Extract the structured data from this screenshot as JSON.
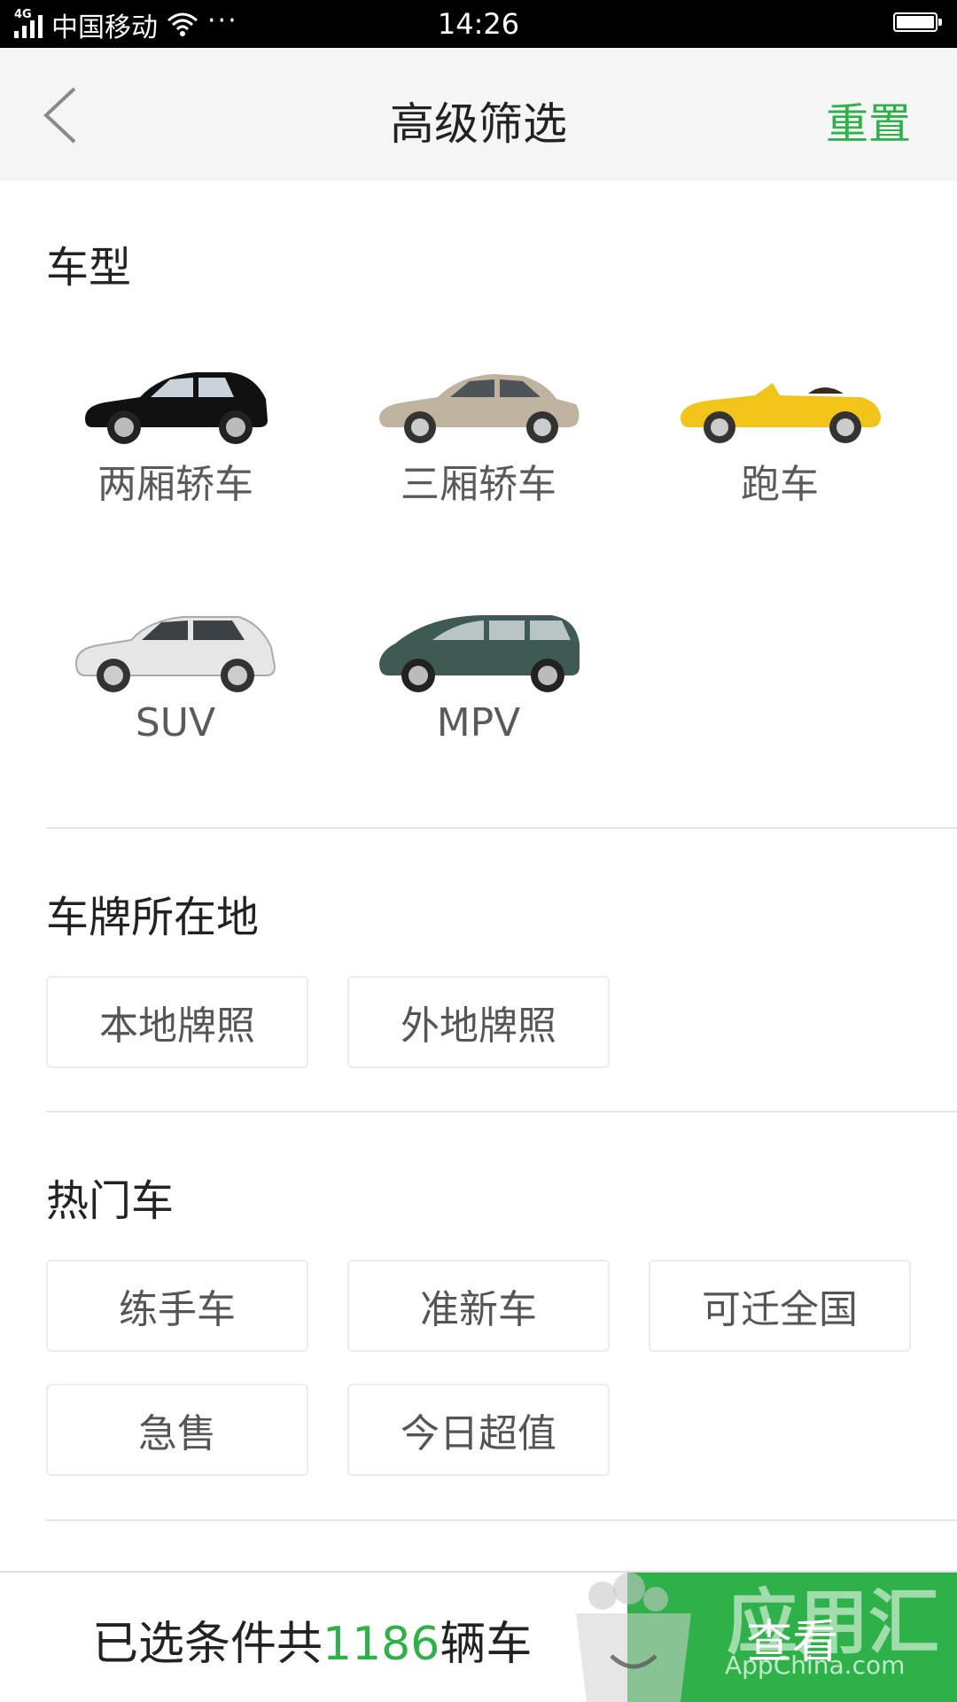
{
  "status_bar": {
    "network": "4G",
    "carrier": "中国移动",
    "more": "···",
    "time": "14:26"
  },
  "header": {
    "title": "高级筛选",
    "reset_label": "重置"
  },
  "sections": {
    "car_type": {
      "title": "车型",
      "items": [
        {
          "label": "两厢轿车",
          "color": "#111111"
        },
        {
          "label": "三厢轿车",
          "color": "#bfb39f"
        },
        {
          "label": "跑车",
          "color": "#f2c318"
        },
        {
          "label": "SUV",
          "color": "#e6e6e6"
        },
        {
          "label": "MPV",
          "color": "#3f5a55"
        }
      ]
    },
    "plate": {
      "title": "车牌所在地",
      "options": [
        "本地牌照",
        "外地牌照"
      ]
    },
    "hot": {
      "title": "热门车",
      "options": [
        "练手车",
        "准新车",
        "可迁全国",
        "急售",
        "今日超值"
      ]
    }
  },
  "footer": {
    "summary_prefix": "已选条件共",
    "count": "1186",
    "summary_suffix": "辆车",
    "view_label": "查看"
  },
  "watermark": {
    "text": "应用汇",
    "subtext": "AppChina.com"
  },
  "colors": {
    "accent": "#2fb14a",
    "nav_bg": "#f5f5f5"
  }
}
